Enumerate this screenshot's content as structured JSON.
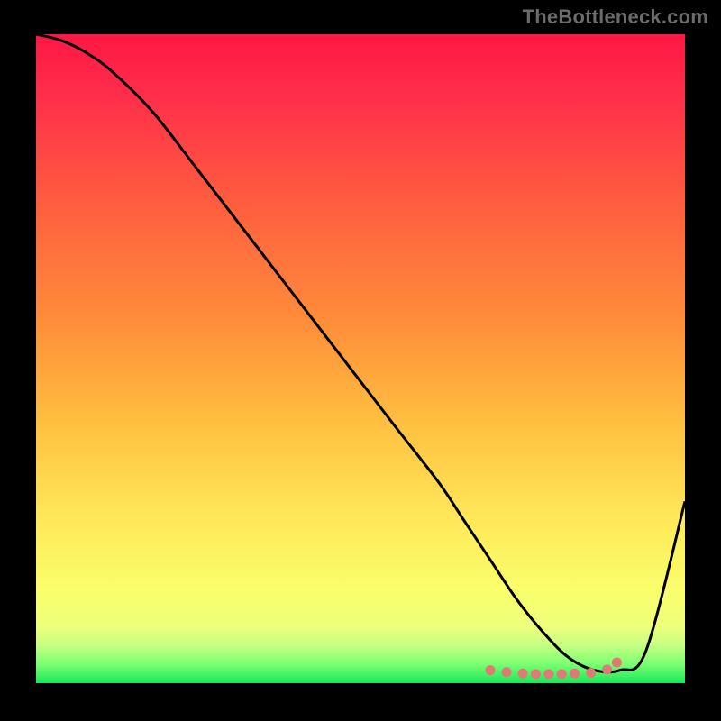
{
  "watermark": "TheBottleneck.com",
  "colors": {
    "background": "#000000",
    "watermark": "#6b6b6b",
    "curve_stroke": "#000000",
    "dots": "#e07a76",
    "gradient_stops": [
      {
        "offset": "0%",
        "color": "#ff1744"
      },
      {
        "offset": "10%",
        "color": "#ff2f4a"
      },
      {
        "offset": "25%",
        "color": "#ff5a3f"
      },
      {
        "offset": "45%",
        "color": "#ff8f3a"
      },
      {
        "offset": "60%",
        "color": "#ffc040"
      },
      {
        "offset": "75%",
        "color": "#ffe95a"
      },
      {
        "offset": "86%",
        "color": "#f9ff6b"
      },
      {
        "offset": "91%",
        "color": "#efff7a"
      },
      {
        "offset": "94%",
        "color": "#c9ff82"
      },
      {
        "offset": "97%",
        "color": "#7dff72"
      },
      {
        "offset": "100%",
        "color": "#19e859"
      }
    ]
  },
  "chart_data": {
    "type": "line",
    "title": "",
    "xlabel": "",
    "ylabel": "",
    "xlim": [
      0,
      100
    ],
    "ylim": [
      0,
      100
    ],
    "grid": false,
    "series": [
      {
        "name": "bottleneck-curve",
        "x": [
          0,
          4,
          8,
          12,
          18,
          25,
          35,
          45,
          55,
          62,
          66,
          70,
          74,
          78,
          82,
          86,
          90,
          94,
          100
        ],
        "y": [
          100,
          99,
          97,
          94,
          88,
          79,
          66,
          53,
          40,
          31,
          25,
          19,
          13,
          8,
          4,
          2,
          2,
          5,
          28
        ]
      }
    ],
    "markers": {
      "name": "valley-dots",
      "x": [
        70,
        72.5,
        75,
        77,
        79,
        81,
        83,
        85.5,
        88,
        89.5
      ],
      "y": [
        2,
        1.7,
        1.5,
        1.4,
        1.4,
        1.4,
        1.5,
        1.6,
        2.1,
        3.2
      ]
    }
  }
}
